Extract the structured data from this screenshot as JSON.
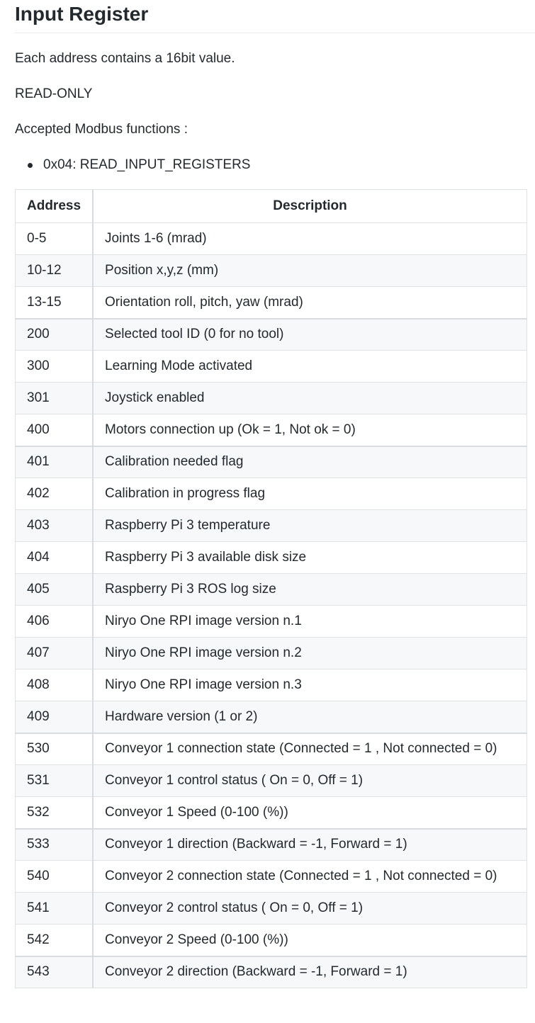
{
  "heading": "Input Register",
  "intro": "Each address contains a 16bit value.",
  "access": "READ-ONLY",
  "functions_label": "Accepted Modbus functions :",
  "functions": [
    "0x04: READ_INPUT_REGISTERS"
  ],
  "table": {
    "headers": [
      "Address",
      "Description"
    ],
    "rows": [
      {
        "address": "0-5",
        "description": "Joints 1-6 (mrad)"
      },
      {
        "address": "10-12",
        "description": "Position x,y,z (mm)"
      },
      {
        "address": "13-15",
        "description": "Orientation roll, pitch, yaw (mrad)"
      },
      {
        "address": "200",
        "description": "Selected tool ID (0 for no tool)"
      },
      {
        "address": "300",
        "description": "Learning Mode activated"
      },
      {
        "address": "301",
        "description": "Joystick enabled"
      },
      {
        "address": "400",
        "description": "Motors connection up (Ok = 1, Not ok = 0)"
      },
      {
        "address": "401",
        "description": "Calibration needed flag"
      },
      {
        "address": "402",
        "description": "Calibration in progress flag"
      },
      {
        "address": "403",
        "description": "Raspberry Pi 3 temperature"
      },
      {
        "address": "404",
        "description": "Raspberry Pi 3 available disk size"
      },
      {
        "address": "405",
        "description": "Raspberry Pi 3 ROS log size"
      },
      {
        "address": "406",
        "description": "Niryo One RPI image version n.1"
      },
      {
        "address": "407",
        "description": "Niryo One RPI image version n.2"
      },
      {
        "address": "408",
        "description": "Niryo One RPI image version n.3"
      },
      {
        "address": "409",
        "description": "Hardware version (1 or 2)"
      },
      {
        "address": "530",
        "description": "Conveyor 1 connection state (Connected = 1 , Not connected = 0)"
      },
      {
        "address": "531",
        "description": "Conveyor 1 control status ( On = 0, Off = 1)"
      },
      {
        "address": "532",
        "description": "Conveyor 1 Speed (0-100 (%))"
      },
      {
        "address": "533",
        "description": "Conveyor 1 direction (Backward = -1, Forward = 1)"
      },
      {
        "address": "540",
        "description": "Conveyor 2 connection state (Connected = 1 , Not connected = 0)"
      },
      {
        "address": "541",
        "description": "Conveyor 2 control status ( On = 0, Off = 1)"
      },
      {
        "address": "542",
        "description": "Conveyor 2 Speed (0-100 (%))"
      },
      {
        "address": "543",
        "description": "Conveyor 2 direction (Backward = -1, Forward = 1)"
      }
    ]
  }
}
